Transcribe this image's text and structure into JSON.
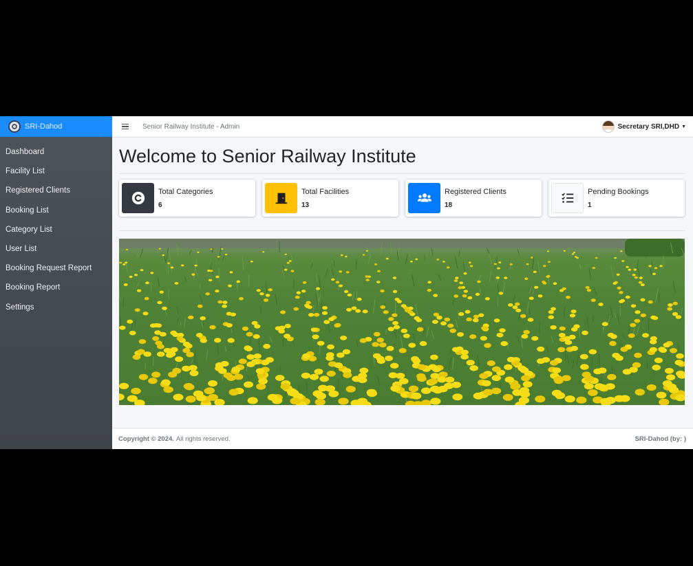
{
  "brand": {
    "name": "SRI-Dahod",
    "logo_icon": "emblem-icon"
  },
  "sidebar": {
    "items": [
      {
        "label": "Dashboard"
      },
      {
        "label": "Facility List"
      },
      {
        "label": "Registered Clients"
      },
      {
        "label": "Booking List"
      },
      {
        "label": "Category List"
      },
      {
        "label": "User List"
      },
      {
        "label": "Booking Request Report"
      },
      {
        "label": "Booking Report"
      },
      {
        "label": "Settings"
      }
    ]
  },
  "topbar": {
    "title": "Senior Railway Institute - Admin",
    "user_name": "Secretary SRI,DHD"
  },
  "page": {
    "title": "Welcome to Senior Railway Institute"
  },
  "stats": [
    {
      "label": "Total Categories",
      "value": "6",
      "icon": "copyright-icon",
      "color": "#343a40"
    },
    {
      "label": "Total Facilities",
      "value": "13",
      "icon": "door-icon",
      "color": "#ffc107"
    },
    {
      "label": "Registered Clients",
      "value": "18",
      "icon": "users-icon",
      "color": "#007bff"
    },
    {
      "label": "Pending Bookings",
      "value": "1",
      "icon": "list-check-icon",
      "color": "#f8f9fa"
    }
  ],
  "footer": {
    "copyright": "Copyright © 2024.",
    "rights": "All rights reserved.",
    "right_text": "SRI-Dahod (by:                  )"
  }
}
